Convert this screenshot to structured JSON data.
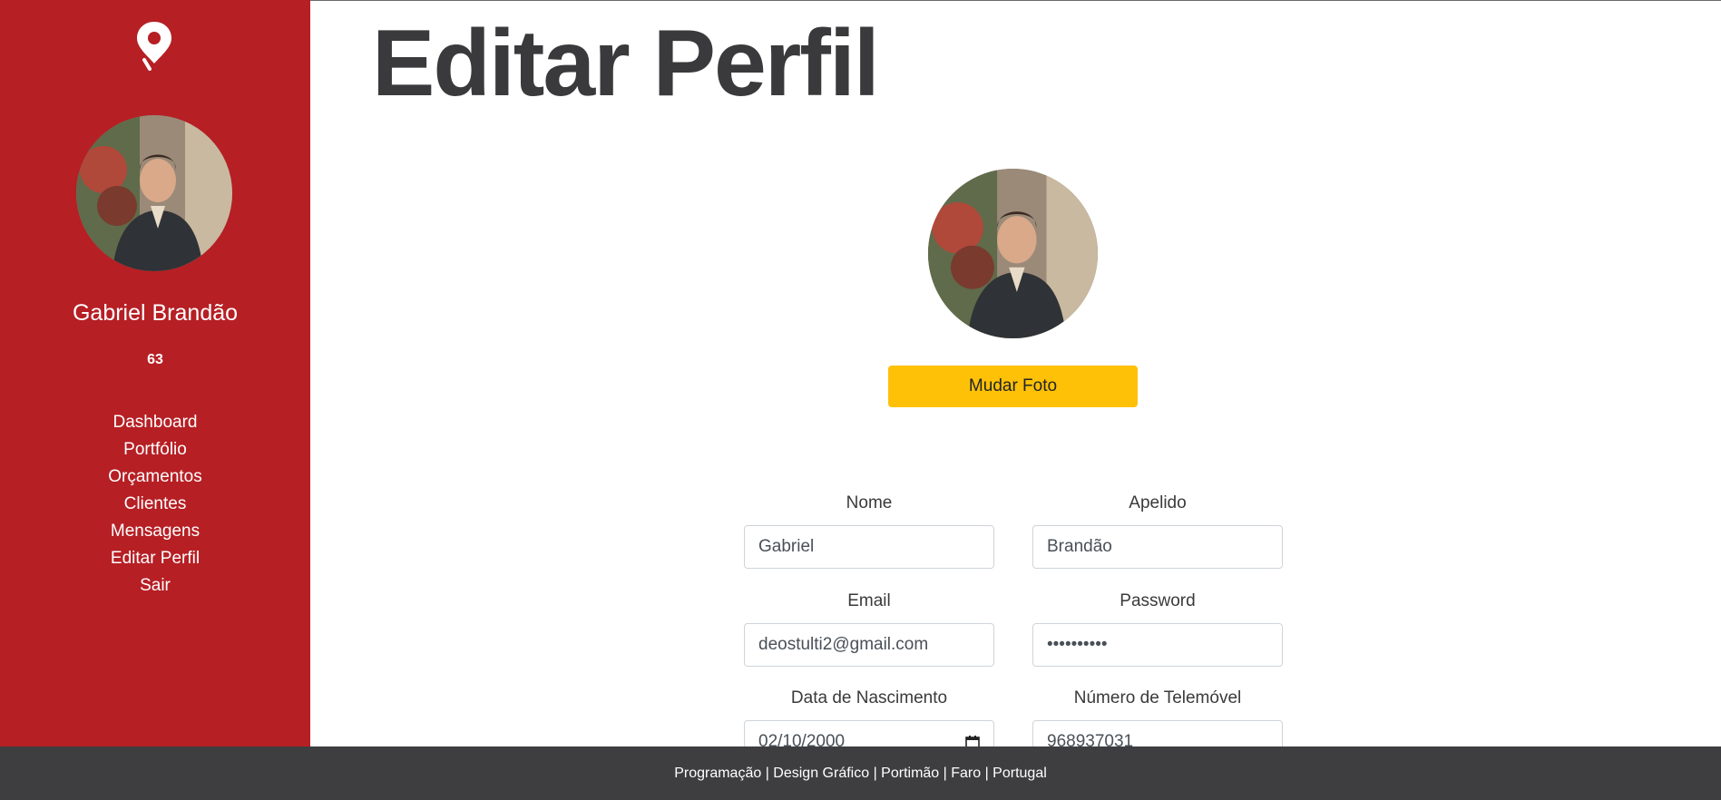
{
  "sidebar": {
    "user_name": "Gabriel Brandão",
    "count": "63",
    "nav": [
      "Dashboard",
      "Portfólio",
      "Orçamentos",
      "Clientes",
      "Mensagens",
      "Editar Perfil",
      "Sair"
    ]
  },
  "main": {
    "title": "Editar Perfil",
    "change_photo_label": "Mudar Foto",
    "fields": {
      "nome": {
        "label": "Nome",
        "value": "Gabriel"
      },
      "apelido": {
        "label": "Apelido",
        "value": "Brandão"
      },
      "email": {
        "label": "Email",
        "value": "deostulti2@gmail.com"
      },
      "password": {
        "label": "Password",
        "value": "••••••••••"
      },
      "nascimento": {
        "label": "Data de Nascimento",
        "value": "02/10/2000"
      },
      "telemovel": {
        "label": "Número de Telemóvel",
        "value": "968937031"
      }
    }
  },
  "footer": {
    "text": "Programação | Design Gráfico | Portimão | Faro | Portugal"
  },
  "colors": {
    "sidebar": "#b61f24",
    "accent_button": "#ffc107",
    "footer": "#3e3e40",
    "title": "#3a3a3c"
  },
  "icons": [
    "map-pin-logo-icon",
    "calendar-icon"
  ]
}
